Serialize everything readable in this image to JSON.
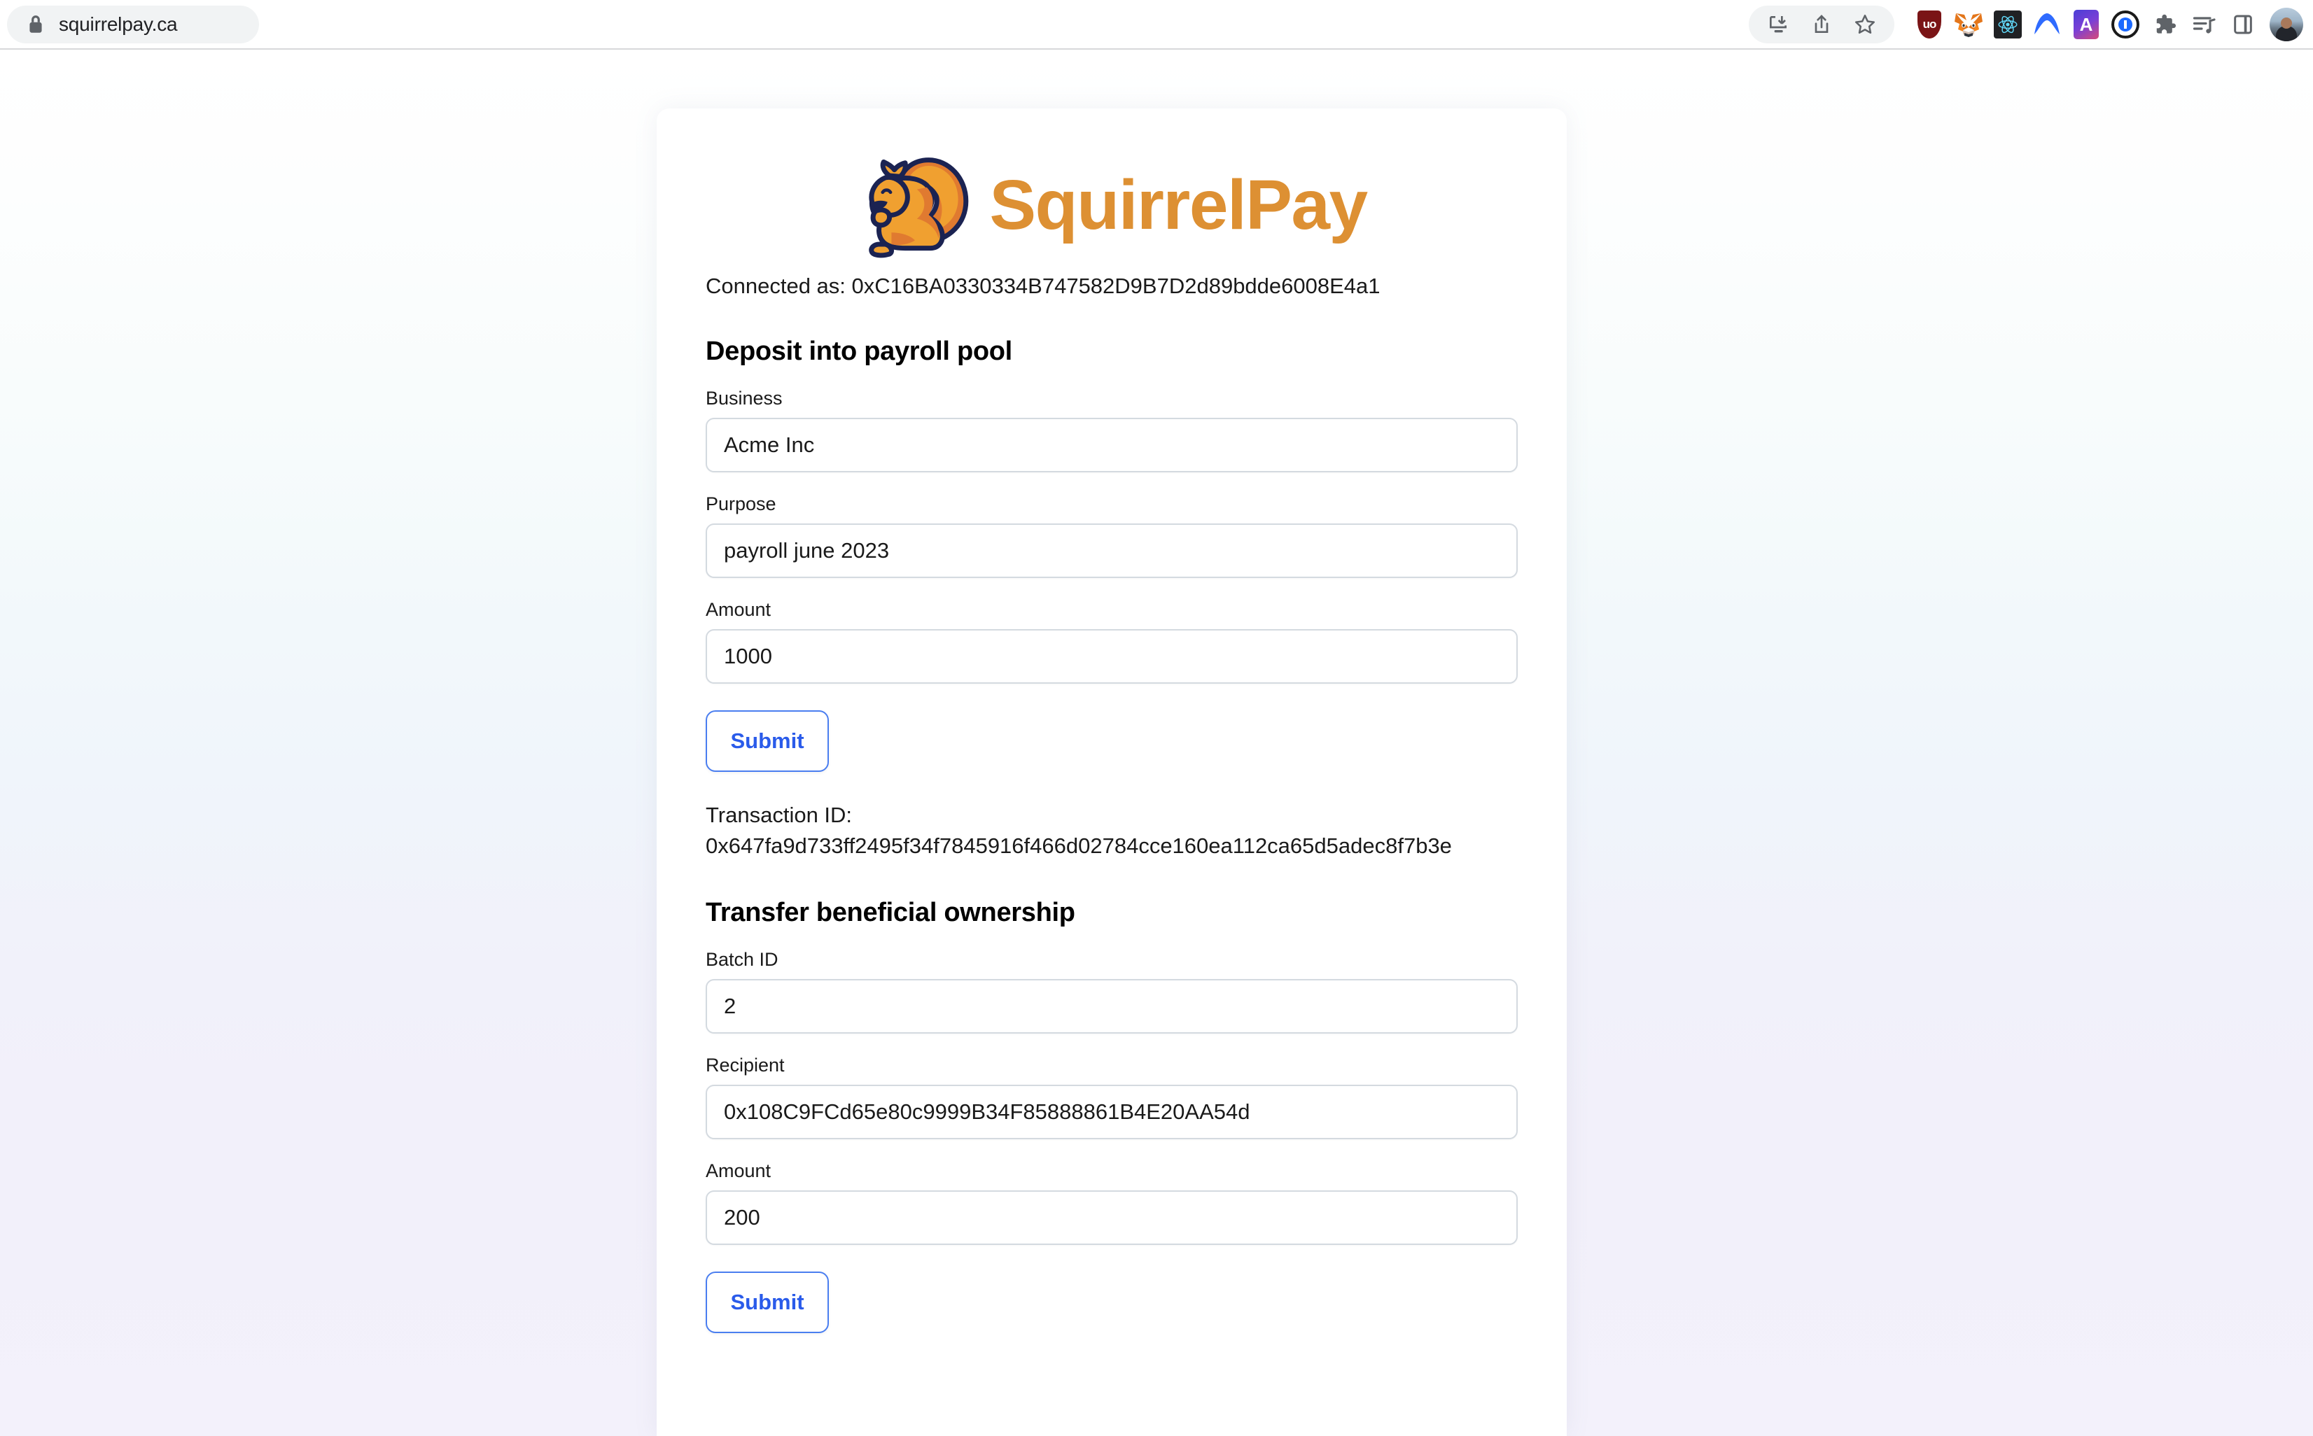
{
  "browser": {
    "url": "squirrelpay.ca",
    "lock_icon": "lock-icon",
    "toolbar": {
      "install_label": "install-app-icon",
      "share_label": "share-icon",
      "bookmark_label": "bookmark-star-icon",
      "extensions": [
        {
          "name": "ublock-origin-icon",
          "glyph": "uo"
        },
        {
          "name": "metamask-icon",
          "glyph": ""
        },
        {
          "name": "react-devtools-icon",
          "glyph": ""
        },
        {
          "name": "arc-wallet-icon",
          "glyph": ""
        },
        {
          "name": "authenticator-icon",
          "glyph": "A"
        },
        {
          "name": "onepassword-icon",
          "glyph": ""
        }
      ],
      "puzzle_label": "extensions-puzzle-icon",
      "readinglist_label": "reading-list-icon",
      "sidepanel_label": "side-panel-icon",
      "profile_label": "profile-avatar"
    }
  },
  "app": {
    "brand_name": "SquirrelPay",
    "brand_color": "#dd9033",
    "logo_icon": "squirrel-logo-icon",
    "connected_line": "Connected as: 0xC16BA0330334B747582D9B7D2d89bdde6008E4a1"
  },
  "deposit_section": {
    "title": "Deposit into payroll pool",
    "fields": [
      {
        "label": "Business",
        "value": "Acme Inc",
        "name": "business-input"
      },
      {
        "label": "Purpose",
        "value": "payroll june 2023",
        "name": "purpose-input"
      },
      {
        "label": "Amount",
        "value": "1000",
        "name": "deposit-amount-input"
      }
    ],
    "submit_label": "Submit",
    "tx_label": "Transaction ID:",
    "tx_value": "0x647fa9d733ff2495f34f7845916f466d02784cce160ea112ca65d5adec8f7b3e"
  },
  "transfer_section": {
    "title": "Transfer beneficial ownership",
    "fields": [
      {
        "label": "Batch ID",
        "value": "2",
        "name": "batch-id-input"
      },
      {
        "label": "Recipient",
        "value": "0x108C9FCd65e80c9999B34F85888861B4E20AA54d",
        "name": "recipient-input"
      },
      {
        "label": "Amount",
        "value": "200",
        "name": "transfer-amount-input"
      }
    ],
    "submit_label": "Submit"
  },
  "theme": {
    "accent_blue": "#2a5bea",
    "border_gray": "#d4dae0",
    "brand_orange": "#dd9033",
    "logo_navy": "#1b2352"
  }
}
